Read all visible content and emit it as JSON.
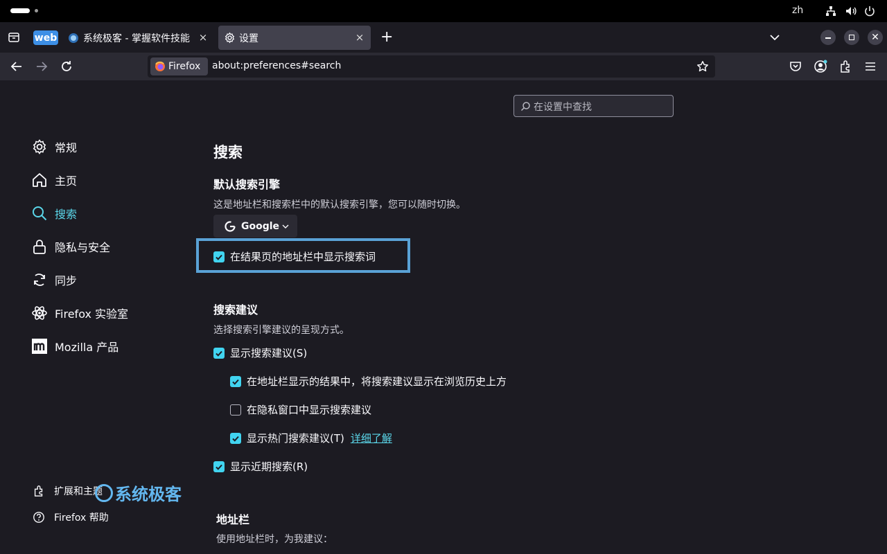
{
  "system_bar": {
    "language": "zh"
  },
  "tabs": [
    {
      "badge": "web",
      "label": "系统极客 - 掌握软件技能",
      "close": "×"
    },
    {
      "label": "设置",
      "close": "×"
    }
  ],
  "tab_new": "+",
  "navbar": {
    "identity_label": "Firefox",
    "url": "about:preferences#search"
  },
  "search": {
    "placeholder": "在设置中查找"
  },
  "sidebar": {
    "items": [
      {
        "label": "常规",
        "icon": "gear-icon"
      },
      {
        "label": "主页",
        "icon": "home-icon"
      },
      {
        "label": "搜索",
        "icon": "search-icon",
        "active": true
      },
      {
        "label": "隐私与安全",
        "icon": "lock-icon"
      },
      {
        "label": "同步",
        "icon": "sync-icon"
      },
      {
        "label": "Firefox 实验室",
        "icon": "atom-icon"
      },
      {
        "label": "Mozilla 产品",
        "icon": "mozilla-icon"
      }
    ],
    "footer": [
      {
        "label": "扩展和主题",
        "icon": "puzzle-icon"
      },
      {
        "label": "Firefox 帮助",
        "icon": "help-icon"
      }
    ]
  },
  "main": {
    "title": "搜索",
    "default_engine": {
      "heading": "默认搜索引擎",
      "description": "这是地址栏和搜索栏中的默认搜索引擎，您可以随时切换。",
      "engine": "Google",
      "show_terms_label": "在结果页的地址栏中显示搜索词"
    },
    "suggestions": {
      "heading": "搜索建议",
      "description": "选择搜索引擎建议的呈现方式。",
      "options": [
        {
          "label": "显示搜索建议(S)",
          "checked": true
        },
        {
          "label": "在地址栏显示的结果中，将搜索建议显示在浏览历史上方",
          "checked": true
        },
        {
          "label": "在隐私窗口中显示搜索建议",
          "checked": false
        },
        {
          "label": "显示热门搜索建议(T)",
          "checked": true,
          "link": "详细了解"
        },
        {
          "label": "显示近期搜索(R)",
          "checked": true
        }
      ]
    },
    "address_bar": {
      "heading": "地址栏",
      "description": "使用地址栏时，为我建议："
    }
  },
  "watermark": "系统极客",
  "colors": {
    "accent": "#5bd7ea",
    "checkbox": "#41d4f0",
    "highlight": "#5aa2d6",
    "background": "#1c1b22"
  }
}
